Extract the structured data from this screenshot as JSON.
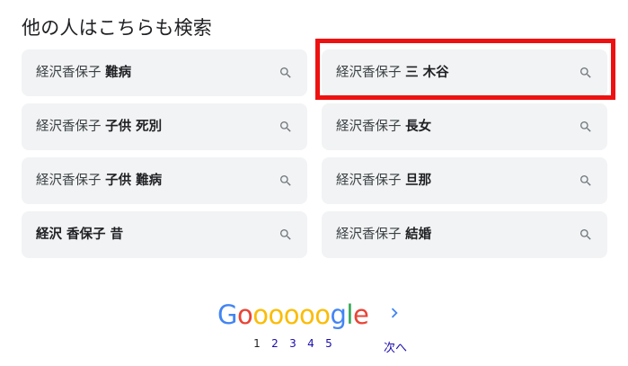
{
  "section_title": "他の人はこちらも検索",
  "searches": [
    {
      "plain": "経沢香保子 ",
      "bold": "難病"
    },
    {
      "plain": "経沢香保子 ",
      "bold": "三 木谷"
    },
    {
      "plain": "経沢香保子 ",
      "bold": "子供 死別"
    },
    {
      "plain": "経沢香保子 ",
      "bold": "長女"
    },
    {
      "plain": "経沢香保子 ",
      "bold": "子供 難病"
    },
    {
      "plain": "経沢香保子 ",
      "bold": "旦那"
    },
    {
      "plain": "",
      "bold": "経沢 香保子 昔"
    },
    {
      "plain": "経沢香保子 ",
      "bold": "結婚"
    }
  ],
  "highlighted_index": 1,
  "pagination": {
    "logo": [
      "G",
      "o",
      "o",
      "o",
      "o",
      "o",
      "o",
      "g",
      "l",
      "e"
    ],
    "pages": [
      "1",
      "2",
      "3",
      "4",
      "5"
    ],
    "current": "1",
    "next_label": "次へ"
  },
  "colors": {
    "highlight_border": "#ee1111",
    "chip_background": "#f1f3f4",
    "link": "#1a0dab",
    "google_blue": "#4285f4",
    "google_red": "#ea4335",
    "google_yellow": "#fbbc05",
    "google_green": "#34a853"
  },
  "icons": {
    "search": "search-icon",
    "next": "chevron-right-icon"
  }
}
